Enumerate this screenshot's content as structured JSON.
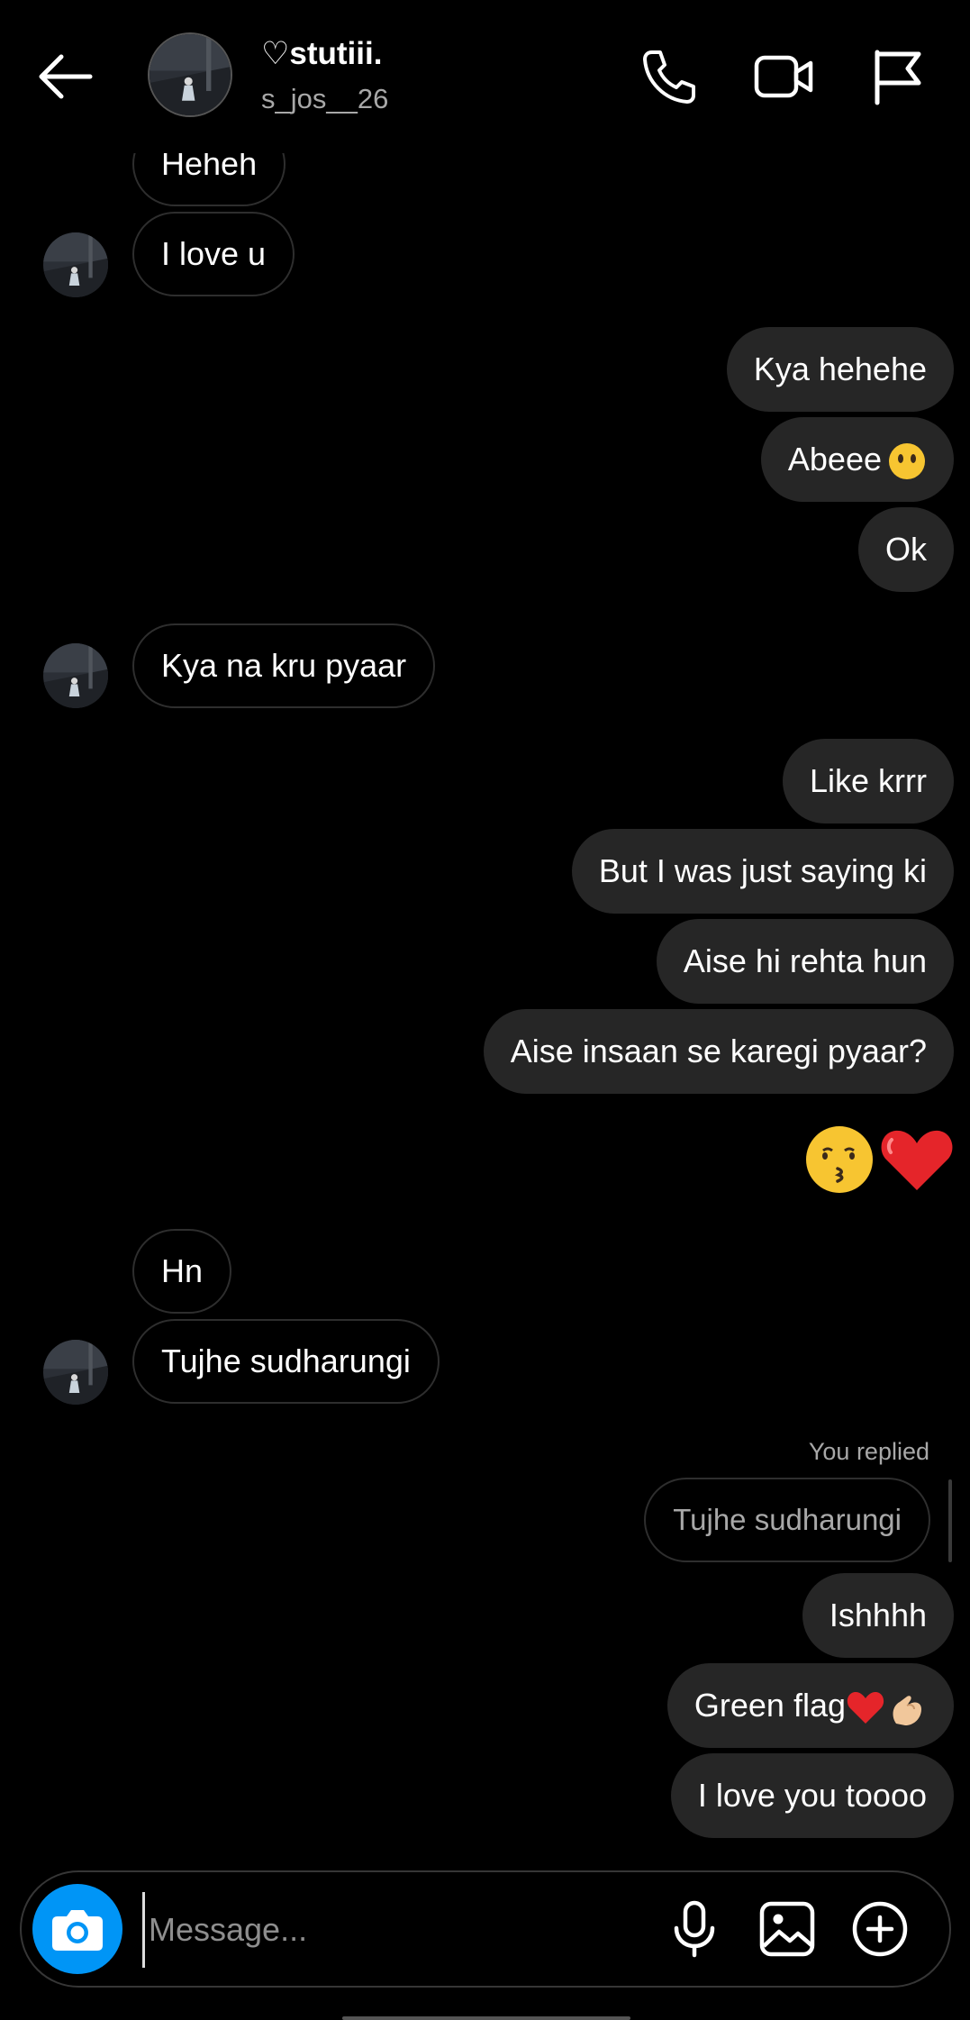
{
  "header": {
    "name": "♡stutiii.",
    "username": "s_jos__26"
  },
  "messages": [
    {
      "dir": "in",
      "text": "Heheh"
    },
    {
      "dir": "in",
      "text": "I love u"
    },
    {
      "dir": "out",
      "text": "Kya hehehe"
    },
    {
      "dir": "out",
      "text": "Abeee",
      "emoji": "neutral-face-no-mouth"
    },
    {
      "dir": "out",
      "text": "Ok"
    },
    {
      "dir": "in",
      "text": "Kya na kru pyaar"
    },
    {
      "dir": "out",
      "text": "Like krrr"
    },
    {
      "dir": "out",
      "text": "But I was just saying ki"
    },
    {
      "dir": "out",
      "text": "Aise hi rehta hun"
    },
    {
      "dir": "out",
      "text": "Aise insaan se karegi pyaar?"
    },
    {
      "dir": "out",
      "emoji": "kissing-face + red-heart"
    },
    {
      "dir": "in",
      "text": "Hn"
    },
    {
      "dir": "in",
      "text": "Tujhe sudharungi"
    },
    {
      "dir": "out",
      "text": "Ishhhh"
    },
    {
      "dir": "out",
      "text": "Green flag",
      "emoji": "red-heart + pinching-hand"
    },
    {
      "dir": "out",
      "text": "I love you toooo"
    }
  ],
  "reply": {
    "label": "You replied",
    "quoted_text": "Tujhe sudharungi"
  },
  "composer": {
    "placeholder": "Message..."
  },
  "colors": {
    "background": "#000000",
    "outgoing_bubble": "#262626",
    "incoming_border": "#2e2e2e",
    "camera_button": "#0095f6",
    "secondary_text": "#a8a8a8"
  }
}
